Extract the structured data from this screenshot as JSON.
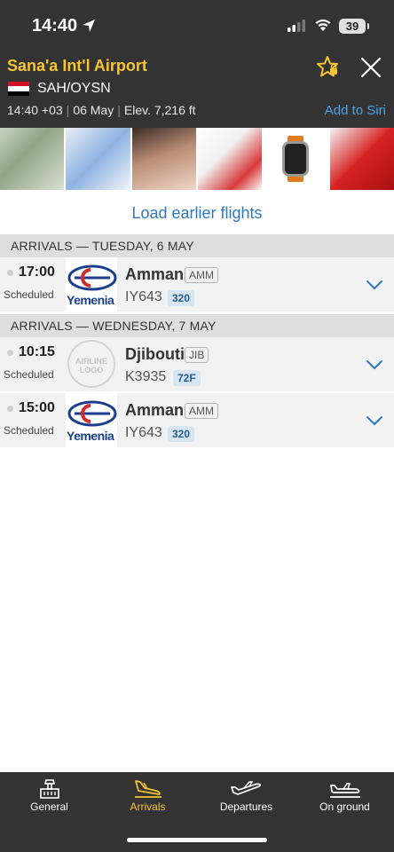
{
  "status_bar": {
    "time": "14:40",
    "battery": "39"
  },
  "airport": {
    "name": "Sana'a Int'l Airport",
    "codes": "SAH/OYSN",
    "local_time": "14:40 +03",
    "date": "06 May",
    "elevation": "Elev. 7,216 ft",
    "siri_label": "Add to Siri",
    "flag_colors": [
      "#ce1126",
      "#ffffff",
      "#000000"
    ]
  },
  "load_earlier_label": "Load earlier flights",
  "sections": [
    {
      "title": "ARRIVALS — TUESDAY, 6 MAY",
      "flights": [
        {
          "time": "17:00",
          "status": "Scheduled",
          "airline_logo": "yemenia-logo",
          "airline_text": "Yemenia",
          "destination": "Amman",
          "iata": "AMM",
          "flight": "IY643",
          "aircraft": "320"
        }
      ]
    },
    {
      "title": "ARRIVALS — WEDNESDAY, 7 MAY",
      "flights": [
        {
          "time": "10:15",
          "status": "Scheduled",
          "airline_logo": "generic-airline-logo",
          "airline_text": "AIRLINE LOGO",
          "destination": "Djibouti",
          "iata": "JIB",
          "flight": "K3935",
          "aircraft": "72F"
        },
        {
          "time": "15:00",
          "status": "Scheduled",
          "airline_logo": "yemenia-logo",
          "airline_text": "Yemenia",
          "destination": "Amman",
          "iata": "AMM",
          "flight": "IY643",
          "aircraft": "320"
        }
      ]
    }
  ],
  "nav": [
    {
      "label": "General",
      "icon": "airport-tower-icon",
      "active": false
    },
    {
      "label": "Arrivals",
      "icon": "plane-landing-icon",
      "active": true
    },
    {
      "label": "Departures",
      "icon": "plane-takeoff-icon",
      "active": false
    },
    {
      "label": "On ground",
      "icon": "plane-on-ground-icon",
      "active": false
    }
  ],
  "colors": {
    "accent": "#f7c531",
    "link": "#2e78c2",
    "header_bg": "#333333",
    "yemenia_blue": "#1b3f8f",
    "yemenia_red": "#d42a2a"
  }
}
